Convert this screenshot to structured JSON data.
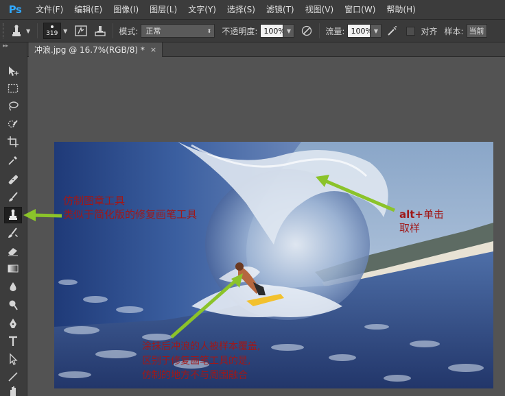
{
  "app": {
    "logo": "Ps"
  },
  "menu": [
    "文件(F)",
    "编辑(E)",
    "图像(I)",
    "图层(L)",
    "文字(Y)",
    "选择(S)",
    "滤镜(T)",
    "视图(V)",
    "窗口(W)",
    "帮助(H)"
  ],
  "options": {
    "brush_size": "319",
    "mode_label": "模式:",
    "mode_value": "正常",
    "opacity_label": "不透明度:",
    "opacity_value": "100%",
    "flow_label": "流量:",
    "flow_value": "100%",
    "align_label": "对齐",
    "sample_label": "样本:",
    "sample_value": "当前"
  },
  "document": {
    "tab_title": "冲浪.jpg @ 16.7%(RGB/8) *",
    "close": "×"
  },
  "annotations": {
    "left_line1": "仿制图章工具",
    "left_line2": "类似于简化版的修复画笔工具",
    "right_line1_bold": "alt+",
    "right_line1_rest": "单击",
    "right_line2": "取样",
    "bottom_line1": "涂抹后冲浪的人被样本覆盖,",
    "bottom_line2": "区别于修复画笔工具的是,",
    "bottom_line3": "仿制的地方不与周围融合"
  },
  "colors": {
    "annotation_text": "#a01818",
    "arrow": "#8bc32a",
    "accent": "#31a8ff"
  }
}
